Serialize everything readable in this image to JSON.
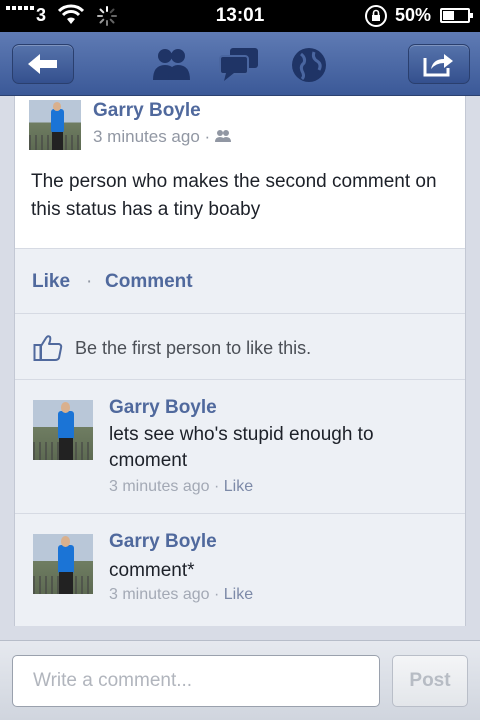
{
  "status_bar": {
    "carrier": "3",
    "time": "13:01",
    "battery": "50%"
  },
  "nav": {
    "icons": [
      "back-arrow-icon",
      "friends-icon",
      "messages-icon",
      "globe-icon",
      "share-icon"
    ]
  },
  "post": {
    "author": "Garry Boyle",
    "time": "3 minutes ago",
    "separator": "·",
    "body": "The person who makes the second comment on this status has a tiny boaby"
  },
  "actions": {
    "like": "Like",
    "dot": "·",
    "comment": "Comment"
  },
  "likes": {
    "text": "Be the first person to like this."
  },
  "comments": [
    {
      "author": "Garry Boyle",
      "text": "lets see who's stupid enough to cmoment",
      "time": "3 minutes ago",
      "sep": "·",
      "like": "Like"
    },
    {
      "author": "Garry Boyle",
      "text": "comment*",
      "time": "3 minutes ago",
      "sep": "·",
      "like": "Like"
    }
  ],
  "composer": {
    "placeholder": "Write a comment...",
    "post_label": "Post"
  },
  "colors": {
    "brand": "#3b5998",
    "link": "#50699d"
  }
}
